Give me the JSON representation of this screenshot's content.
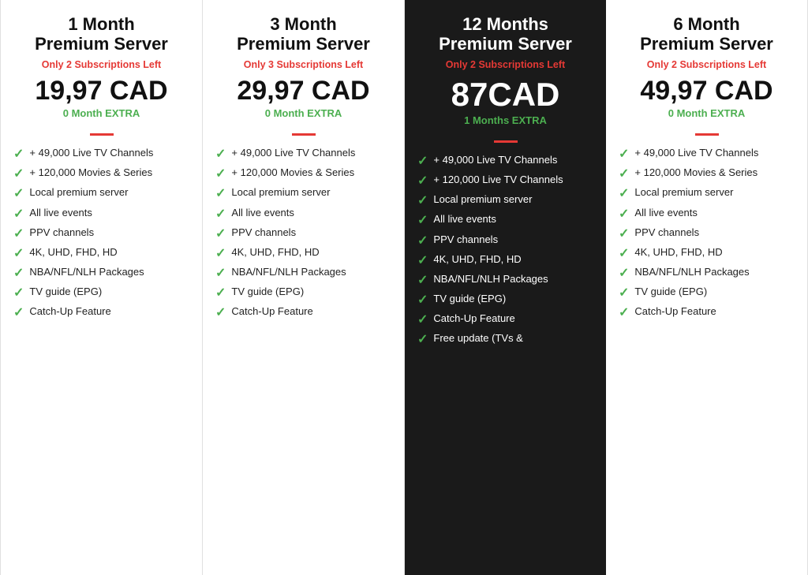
{
  "plans": [
    {
      "id": "1month",
      "title": "1 Month\nPremium Server",
      "subscriptions_left": "Only 2 Subscriptions Left",
      "price": "19,97 CAD",
      "extra": "0 Month EXTRA",
      "featured": false,
      "features": [
        "+ 49,000 Live TV Channels",
        "+ 120,000 Movies & Series",
        "Local premium server",
        "All live events",
        "PPV channels",
        "4K, UHD, FHD, HD",
        "NBA/NFL/NLH Packages",
        "TV guide (EPG)",
        "Catch-Up Feature"
      ]
    },
    {
      "id": "3month",
      "title": "3 Month\nPremium Server",
      "subscriptions_left": "Only 3 Subscriptions Left",
      "price": "29,97 CAD",
      "extra": "0 Month EXTRA",
      "featured": false,
      "features": [
        "+ 49,000 Live TV Channels",
        "+ 120,000 Movies & Series",
        "Local premium server",
        "All live events",
        "PPV channels",
        "4K, UHD, FHD, HD",
        "NBA/NFL/NLH Packages",
        "TV guide (EPG)",
        "Catch-Up Feature"
      ]
    },
    {
      "id": "12month",
      "title": "12 Months\nPremium Server",
      "subscriptions_left": "Only 2 Subscriptions Left",
      "price": "87CAD",
      "extra": "1 Months EXTRA",
      "featured": true,
      "features": [
        "+ 49,000 Live TV Channels",
        "+ 120,000 Live TV Channels",
        "Local premium server",
        "All live events",
        "PPV channels",
        "4K, UHD, FHD, HD",
        "NBA/NFL/NLH Packages",
        "TV guide (EPG)",
        "Catch-Up Feature",
        "Free update (TVs &"
      ]
    },
    {
      "id": "6month",
      "title": "6 Month\nPremium Server",
      "subscriptions_left": "Only 2 Subscriptions Left",
      "price": "49,97 CAD",
      "extra": "0 Month EXTRA",
      "featured": false,
      "features": [
        "+ 49,000 Live TV Channels",
        "+ 120,000 Movies & Series",
        "Local premium server",
        "All live events",
        "PPV channels",
        "4K, UHD, FHD, HD",
        "NBA/NFL/NLH Packages",
        "TV guide (EPG)",
        "Catch-Up Feature"
      ]
    }
  ],
  "labels": {
    "subscriptions_icon": "✓",
    "checkmark": "✓"
  }
}
